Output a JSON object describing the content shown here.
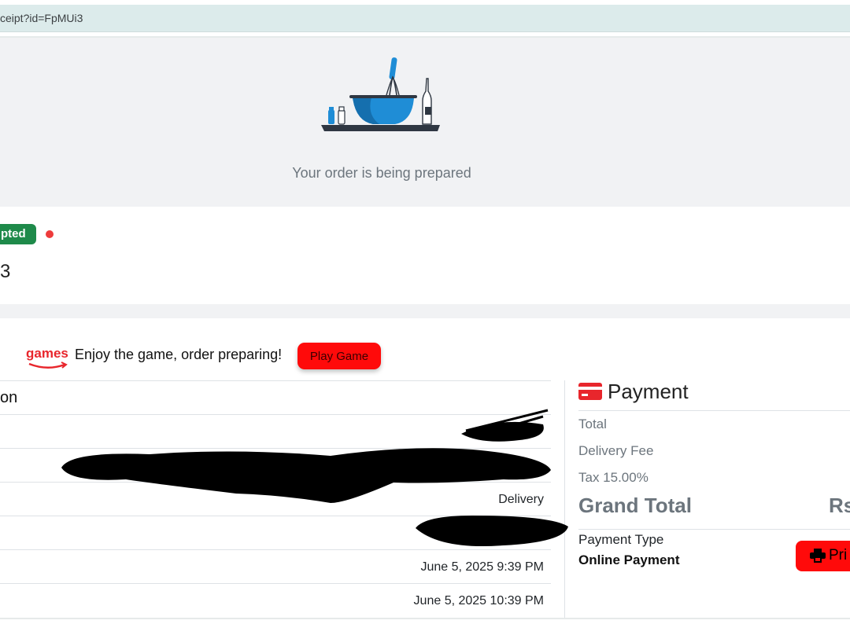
{
  "browser": {
    "url_fragment": "ceipt?id=FpMUi3"
  },
  "status": {
    "message": "Your order is being prepared"
  },
  "order": {
    "badge": "pted",
    "number_fragment": "3"
  },
  "promo": {
    "logo_text": "games",
    "text": "Enjoy the game, order preparing!",
    "button_label": "Play Game"
  },
  "details": {
    "rows": [
      {
        "label": "on",
        "value": ""
      },
      {
        "label": "",
        "value": ""
      },
      {
        "label": "",
        "value": ""
      },
      {
        "label": "",
        "value": "Delivery"
      },
      {
        "label": "",
        "value": ""
      },
      {
        "label": "",
        "value": "June 5, 2025 9:39 PM"
      },
      {
        "label": "",
        "value": "June 5, 2025 10:39 PM"
      }
    ]
  },
  "payment": {
    "title": "Payment",
    "total_label": "Total",
    "delivery_fee_label": "Delivery Fee",
    "tax_label": "Tax 15.00%",
    "grand_total_label": "Grand Total",
    "grand_total_value_fragment": "Rs",
    "payment_type_label": "Payment Type",
    "payment_type_value": "Online Payment",
    "print_label_fragment": "Pri"
  },
  "colors": {
    "accent": "#ff0a0a",
    "success": "#1e8a4a",
    "bowl": "#1f8dd6"
  }
}
